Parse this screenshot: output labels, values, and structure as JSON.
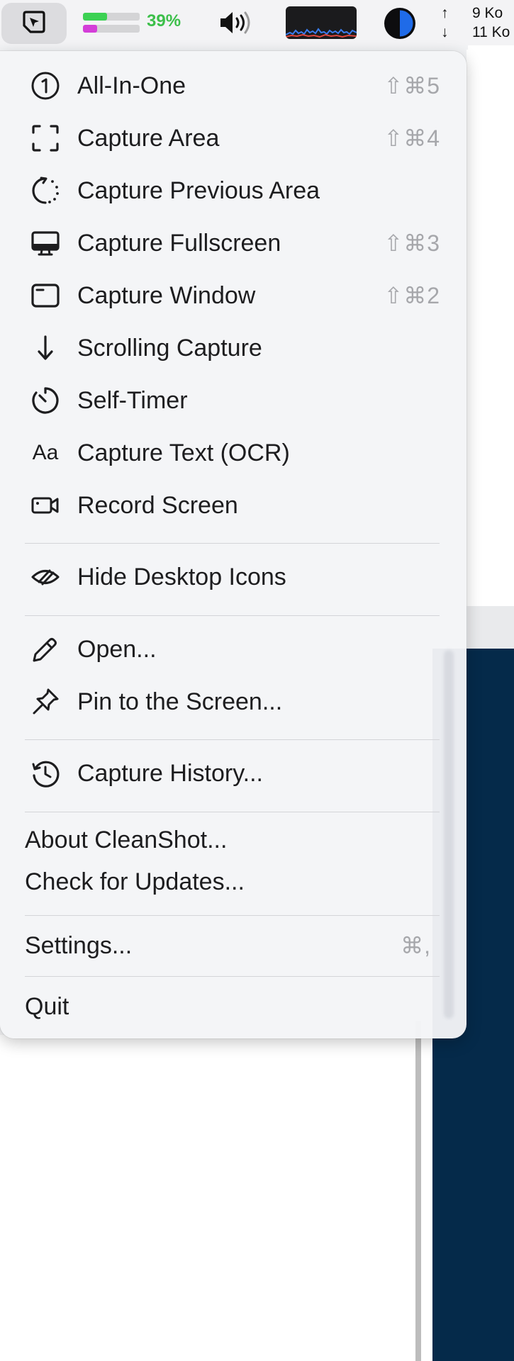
{
  "menubar": {
    "battery_pct": "39%",
    "battery_bars": [
      {
        "level": 0.42,
        "color": "#3cd153"
      },
      {
        "level": 0.25,
        "color": "#d43ed8"
      }
    ],
    "net_up_arrow": "↑",
    "net_up": "9 Ko",
    "net_down_arrow": "↓",
    "net_down": "11 Ko",
    "icons": [
      "cleanshot-icon",
      "volume-icon",
      "cpu-graph-icon",
      "disk-pie-icon"
    ]
  },
  "menu": {
    "items": [
      {
        "label": "All-In-One",
        "icon": "circle-one-icon",
        "shortcut": "⇧⌘5"
      },
      {
        "label": "Capture Area",
        "icon": "capture-area-icon",
        "shortcut": "⇧⌘4"
      },
      {
        "label": "Capture Previous Area",
        "icon": "previous-area-icon",
        "shortcut": ""
      },
      {
        "label": "Capture Fullscreen",
        "icon": "monitor-icon",
        "shortcut": "⇧⌘3"
      },
      {
        "label": "Capture Window",
        "icon": "window-icon",
        "shortcut": "⇧⌘2"
      },
      {
        "label": "Scrolling Capture",
        "icon": "arrow-down-icon",
        "shortcut": ""
      },
      {
        "label": "Self-Timer",
        "icon": "timer-icon",
        "shortcut": ""
      },
      {
        "label": "Capture Text (OCR)",
        "icon": "text-aa-icon",
        "icon_text": "Aa",
        "shortcut": ""
      },
      {
        "label": "Record Screen",
        "icon": "video-camera-icon",
        "shortcut": ""
      },
      {
        "label": "Hide Desktop Icons",
        "icon": "eye-slash-icon",
        "shortcut": ""
      },
      {
        "label": "Open...",
        "icon": "pencil-icon",
        "shortcut": ""
      },
      {
        "label": "Pin to the Screen...",
        "icon": "pin-icon",
        "shortcut": ""
      },
      {
        "label": "Capture History...",
        "icon": "history-icon",
        "shortcut": ""
      },
      {
        "label": "About CleanShot...",
        "shortcut": ""
      },
      {
        "label": "Check for Updates...",
        "shortcut": ""
      },
      {
        "label": "Settings...",
        "shortcut": "⌘,"
      },
      {
        "label": "Quit",
        "shortcut": ""
      }
    ]
  },
  "colors": {
    "battery_text": "#3cbf4a",
    "shortcut_text": "#a6a7ab",
    "background_navy": "#052a4a"
  }
}
